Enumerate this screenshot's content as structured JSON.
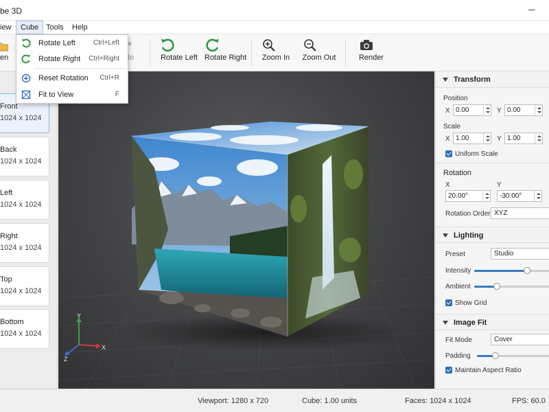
{
  "window": {
    "title": "be 3D"
  },
  "menu": {
    "items": [
      "iew",
      "Cube",
      "Tools",
      "Help"
    ],
    "open": "Cube"
  },
  "cube_menu": [
    {
      "label": "Rotate Left",
      "shortcut": "Ctrl+Left",
      "icon": "rotate-left-icon"
    },
    {
      "label": "Rotate Right",
      "shortcut": "Ctrl+Right",
      "icon": "rotate-right-icon"
    },
    {
      "label": "Reset Rotation",
      "shortcut": "Ctrl+R",
      "icon": "reset-rotation-icon"
    },
    {
      "label": "Fit to View",
      "shortcut": "F",
      "icon": "fit-to-view-icon"
    }
  ],
  "toolbar": {
    "open": "en",
    "redo": "do",
    "rotate_left": "Rotate Left",
    "rotate_right": "Rotate Right",
    "zoom_in": "Zoom In",
    "zoom_out": "Zoom Out",
    "render": "Render"
  },
  "faces": [
    {
      "name": "Front",
      "size": "1024 x 1024",
      "selected": true
    },
    {
      "name": "Back",
      "size": "1024 x 1024"
    },
    {
      "name": "Left",
      "size": "1024 x 1024"
    },
    {
      "name": "Right",
      "size": "1024 x 1024"
    },
    {
      "name": "Top",
      "size": "1024 x 1024"
    },
    {
      "name": "Bottom",
      "size": "1024 x 1024"
    }
  ],
  "axes": {
    "x": "X",
    "y": "Y",
    "z": "Z"
  },
  "panel": {
    "transform": {
      "title": "Transform",
      "position_label": "Position",
      "x_label": "X",
      "y_label": "Y",
      "pos_x": "0.00",
      "pos_y": "0.00",
      "scale_label": "Scale",
      "scale_x": "1.00",
      "scale_y": "1.00",
      "uniform_scale": "Uniform Scale",
      "uniform_scale_checked": true
    },
    "rotation": {
      "title": "Rotation",
      "x_label": "X",
      "y_label": "Y",
      "x": "20.00°",
      "y": "-30.00°",
      "order_label": "Rotation Order",
      "order": "XYZ"
    },
    "lighting": {
      "title": "Lighting",
      "preset_label": "Preset",
      "preset": "Studio",
      "intensity_label": "Intensity",
      "intensity": 0.7,
      "ambient_label": "Ambient",
      "ambient": 0.3,
      "show_grid": "Show Grid",
      "show_grid_checked": true
    },
    "image_fit": {
      "title": "Image Fit",
      "fit_mode_label": "Fit Mode",
      "fit_mode": "Cover",
      "padding_label": "Padding",
      "padding": 0.25,
      "maintain_aspect": "Maintain Aspect Ratio",
      "maintain_aspect_checked": true
    }
  },
  "status": {
    "viewport": "Viewport:  1280 x 720",
    "cube": "Cube:  1.00 units",
    "faces": "Faces:  1024 x 1024",
    "fps": "FPS: 60.0"
  },
  "colors": {
    "accent": "#2f6fb9",
    "icon_green": "#2e9a3c",
    "viewport_bg": "#444547"
  }
}
